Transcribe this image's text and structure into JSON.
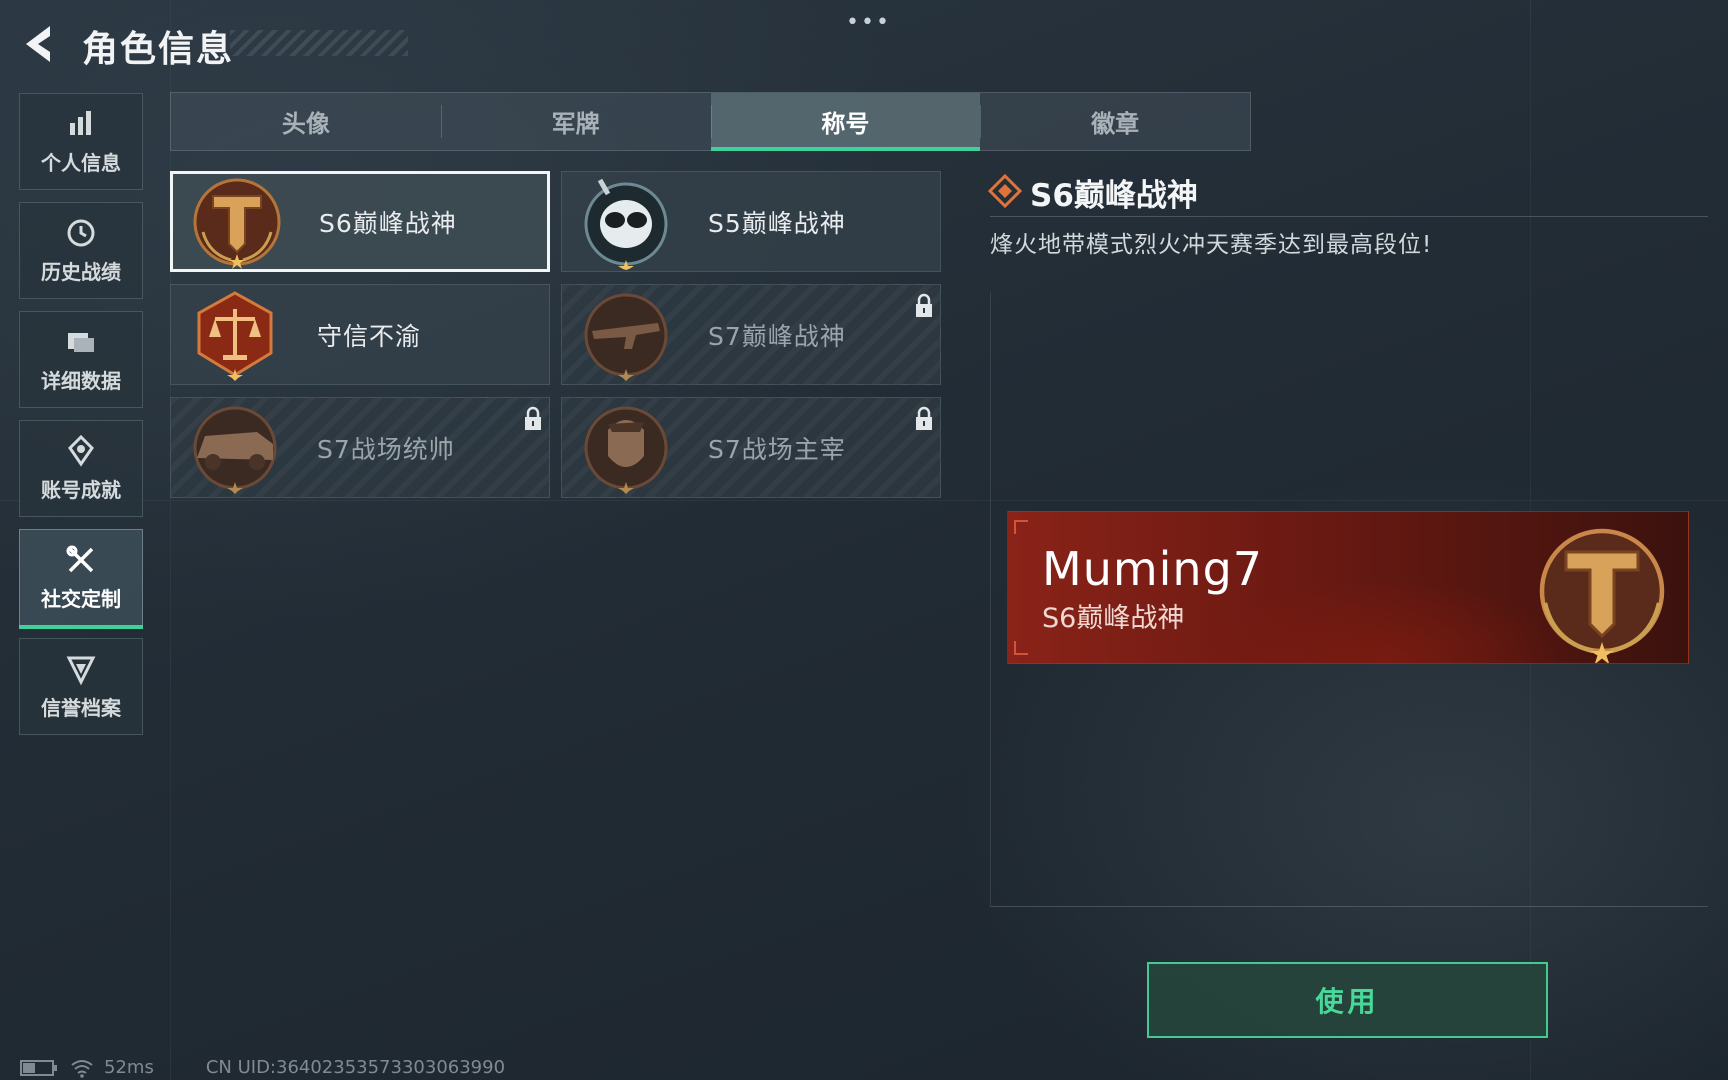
{
  "header": {
    "title": "角色信息",
    "menu_dots": "•••"
  },
  "sidebar": {
    "items": [
      {
        "label": "个人信息",
        "icon": "bar-chart-icon",
        "active": false
      },
      {
        "label": "历史战绩",
        "icon": "history-clock-icon",
        "active": false
      },
      {
        "label": "详细数据",
        "icon": "folder-data-icon",
        "active": false
      },
      {
        "label": "账号成就",
        "icon": "achievement-icon",
        "active": false
      },
      {
        "label": "社交定制",
        "icon": "tools-icon",
        "active": true
      },
      {
        "label": "信誉档案",
        "icon": "credit-badge-icon",
        "active": false
      }
    ]
  },
  "tabs": [
    {
      "label": "头像",
      "active": false
    },
    {
      "label": "军牌",
      "active": false
    },
    {
      "label": "称号",
      "active": true
    },
    {
      "label": "徽章",
      "active": false
    }
  ],
  "titles": [
    {
      "label": "S6巅峰战神",
      "emblem": "t-shield-emblem",
      "locked": false,
      "selected": true
    },
    {
      "label": "S5巅峰战神",
      "emblem": "skull-goggles-emblem",
      "locked": false,
      "selected": false
    },
    {
      "label": "守信不渝",
      "emblem": "scales-emblem",
      "locked": false,
      "selected": false
    },
    {
      "label": "S7巅峰战神",
      "emblem": "rifle-emblem",
      "locked": true,
      "selected": false
    },
    {
      "label": "S7战场统帅",
      "emblem": "armored-vehicle-emblem",
      "locked": true,
      "selected": false
    },
    {
      "label": "S7战场主宰",
      "emblem": "soldier-portrait-emblem",
      "locked": true,
      "selected": false
    }
  ],
  "detail": {
    "name": "S6巅峰战神",
    "description": "烽火地带模式烈火冲天赛季达到最高段位!"
  },
  "preview": {
    "player_name": "Muming7",
    "title": "S6巅峰战神"
  },
  "use_button": {
    "label": "使用"
  },
  "status": {
    "ping": "52ms",
    "uid": "CN UID:36402353573303063990"
  },
  "colors": {
    "accent_green": "#3fd19a",
    "banner_red": "#8a2318",
    "emblem_gold": "#d8a25a"
  }
}
